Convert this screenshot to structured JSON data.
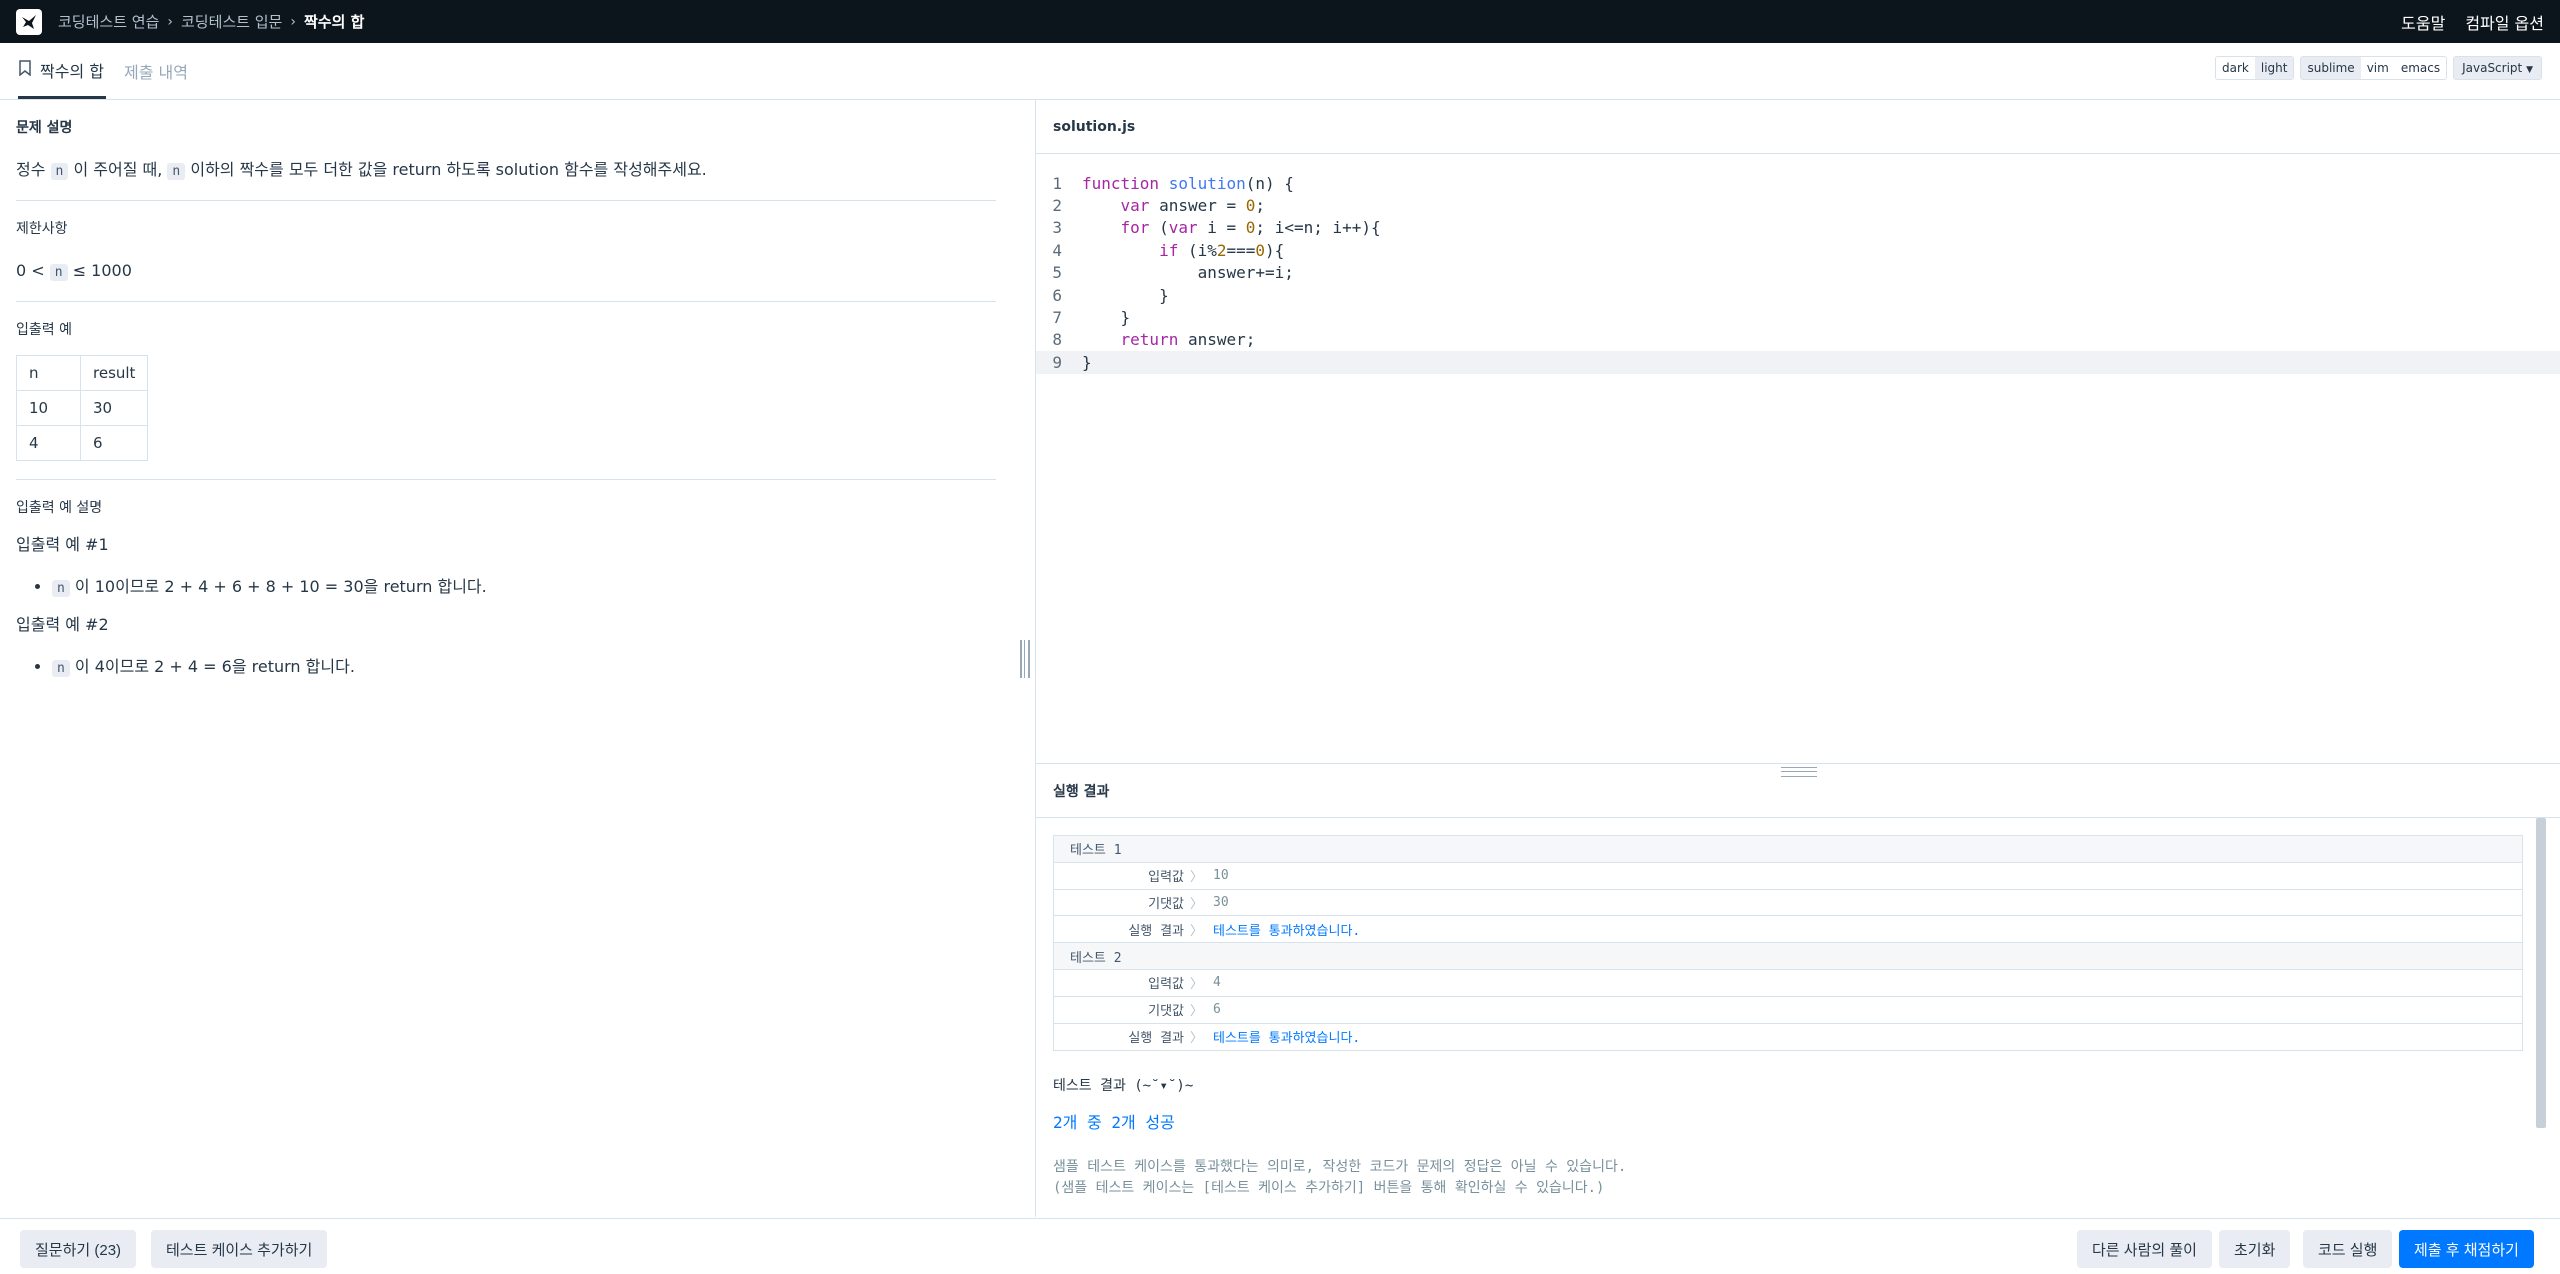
{
  "nav": {
    "breadcrumb": [
      "코딩테스트 연습",
      "코딩테스트 입문",
      "짝수의 합"
    ],
    "help": "도움말",
    "compile_options": "컴파일 옵션"
  },
  "tabs": {
    "problem": "짝수의 합",
    "submissions": "제출 내역"
  },
  "editor_options": {
    "themes": [
      "dark",
      "light"
    ],
    "keymaps": [
      "sublime",
      "vim",
      "emacs"
    ],
    "language": "JavaScript"
  },
  "problem": {
    "desc_title": "문제 설명",
    "desc_p1": "정수",
    "desc_code1": "n",
    "desc_p2": "이 주어질 때,",
    "desc_code2": "n",
    "desc_p3": "이하의 짝수를 모두 더한 값을 return 하도록 solution 함수를 작성해주세요.",
    "limit_title": "제한사항",
    "limit_p1": "0 <",
    "limit_code": "n",
    "limit_p2": "≤ 1000",
    "io_title": "입출력 예",
    "io_headers": [
      "n",
      "result"
    ],
    "io_rows": [
      [
        "10",
        "30"
      ],
      [
        "4",
        "6"
      ]
    ],
    "io_desc_title": "입출력 예 설명",
    "ex1_title": "입출력 예 #1",
    "ex1_code": "n",
    "ex1_text": "이 10이므로 2 + 4 + 6 + 8 + 10 = 30을 return 합니다.",
    "ex2_title": "입출력 예 #2",
    "ex2_code": "n",
    "ex2_text": "이 4이므로 2 + 4 = 6을 return 합니다."
  },
  "editor": {
    "filename": "solution.js",
    "line_numbers": [
      "1",
      "2",
      "3",
      "4",
      "5",
      "6",
      "7",
      "8",
      "9"
    ]
  },
  "result": {
    "title": "실행 결과",
    "tests": [
      {
        "name": "테스트 1",
        "input_label": "입력값",
        "input": "10",
        "expected_label": "기댓값",
        "expected": "30",
        "result_label": "실행 결과",
        "result": "테스트를 통과하였습니다."
      },
      {
        "name": "테스트 2",
        "input_label": "입력값",
        "input": "4",
        "expected_label": "기댓값",
        "expected": "6",
        "result_label": "실행 결과",
        "result": "테스트를 통과하였습니다."
      }
    ],
    "summary": "테스트 결과 (~˘▾˘)~",
    "success": "2개 중 2개 성공",
    "note1": "샘플 테스트 케이스를 통과했다는 의미로, 작성한 코드가 문제의 정답은 아닐 수 있습니다.",
    "note2": "(샘플 테스트 케이스는 [테스트 케이스 추가하기] 버튼을 통해 확인하실 수 있습니다.)"
  },
  "footer": {
    "ask": "질문하기 (23)",
    "add_test": "테스트 케이스 추가하기",
    "others": "다른 사람의 풀이",
    "reset": "초기화",
    "run": "코드 실행",
    "submit": "제출 후 채점하기"
  }
}
